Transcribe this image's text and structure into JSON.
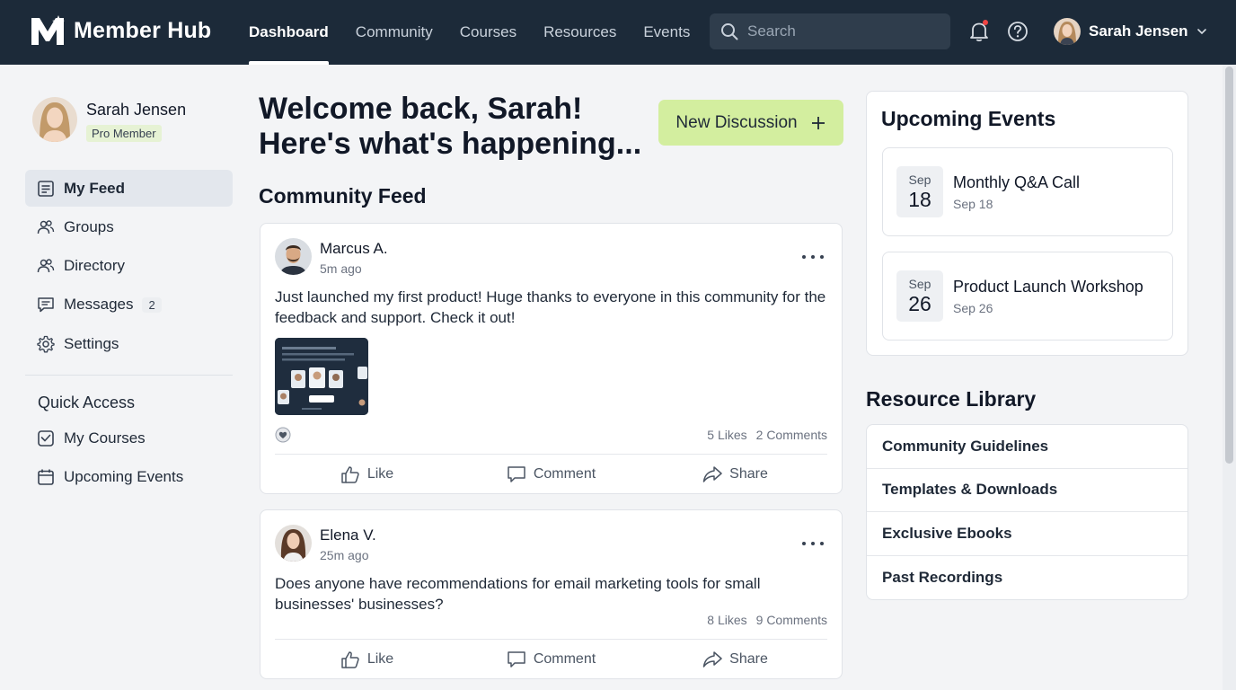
{
  "app": {
    "name": "Member Hub"
  },
  "nav": {
    "items": [
      {
        "label": "Dashboard",
        "active": true
      },
      {
        "label": "Community"
      },
      {
        "label": "Courses"
      },
      {
        "label": "Resources"
      },
      {
        "label": "Events"
      }
    ]
  },
  "search": {
    "placeholder": "Search"
  },
  "user": {
    "name": "Sarah Jensen",
    "badge": "Pro Member"
  },
  "sidebar": {
    "items": [
      {
        "label": "My Feed",
        "icon": "feed-icon",
        "active": true
      },
      {
        "label": "Groups",
        "icon": "groups-icon"
      },
      {
        "label": "Directory",
        "icon": "directory-icon"
      },
      {
        "label": "Messages",
        "icon": "messages-icon",
        "count": "2"
      },
      {
        "label": "Settings",
        "icon": "gear-icon"
      }
    ],
    "quick_access_title": "Quick Access",
    "quick_access": [
      {
        "label": "My Courses",
        "icon": "checkbox-icon"
      },
      {
        "label": "Upcoming Events",
        "icon": "calendar-icon"
      }
    ]
  },
  "main": {
    "welcome_line1": "Welcome back, Sarah!",
    "welcome_line2": "Here's what's happening...",
    "new_discussion": "New Discussion",
    "feed_title": "Community Feed",
    "posts": [
      {
        "author": "Marcus A.",
        "time": "5m ago",
        "text": "Just launched my first product! Huge thanks to everyone in this community for the feedback and support. Check it out!",
        "likes": "5 Likes",
        "comments": "2 Comments",
        "has_image": true
      },
      {
        "author": "Elena V.",
        "time": "25m ago",
        "text": "Does anyone have recommendations for email marketing tools for small businesses' businesses?",
        "likes": "8 Likes",
        "comments": "9 Comments"
      }
    ],
    "actions": {
      "like": "Like",
      "comment": "Comment",
      "share": "Share"
    }
  },
  "events": {
    "title": "Upcoming Events",
    "items": [
      {
        "month": "Sep",
        "day": "18",
        "name": "Monthly Q&A Call",
        "date": "Sep 18"
      },
      {
        "month": "Sep",
        "day": "26",
        "name": "Product Launch Workshop",
        "date": "Sep 26"
      }
    ]
  },
  "resources": {
    "title": "Resource Library",
    "items": [
      "Community Guidelines",
      "Templates & Downloads",
      "Exclusive Ebooks",
      "Past Recordings"
    ]
  },
  "colors": {
    "topbar": "#1c2a39",
    "accent": "#d3ee9f",
    "notification_dot": "#ef4444"
  }
}
